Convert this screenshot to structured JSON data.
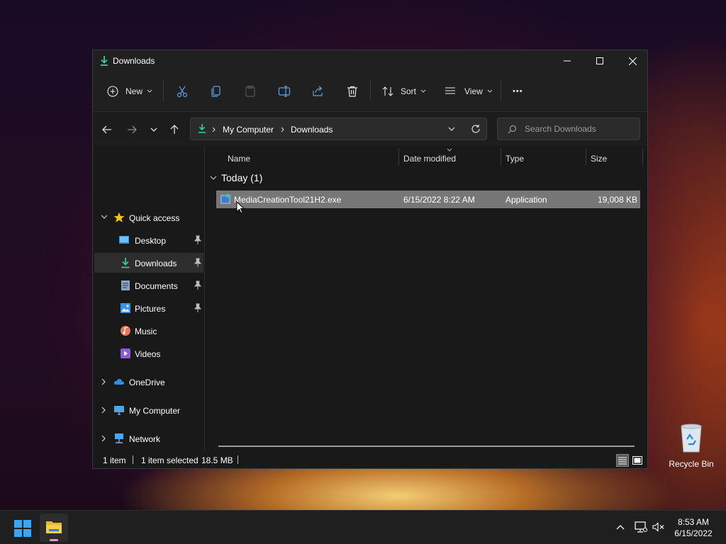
{
  "window": {
    "title": "Downloads",
    "controls": {
      "minimize": "minimize",
      "maximize": "maximize",
      "close": "close"
    }
  },
  "toolbar": {
    "new_label": "New",
    "sort_label": "Sort",
    "view_label": "View",
    "more_label": "•••"
  },
  "address": {
    "segments": [
      "My Computer",
      "Downloads"
    ]
  },
  "search": {
    "placeholder": "Search Downloads"
  },
  "sidebar": {
    "quick_access": "Quick access",
    "items": [
      {
        "label": "Desktop",
        "icon": "desktop-icon",
        "pinned": true
      },
      {
        "label": "Downloads",
        "icon": "download-icon",
        "pinned": true,
        "selected": true
      },
      {
        "label": "Documents",
        "icon": "documents-icon",
        "pinned": true
      },
      {
        "label": "Pictures",
        "icon": "pictures-icon",
        "pinned": true
      },
      {
        "label": "Music",
        "icon": "music-icon",
        "pinned": false
      },
      {
        "label": "Videos",
        "icon": "videos-icon",
        "pinned": false
      }
    ],
    "onedrive": "OneDrive",
    "mycomputer": "My Computer",
    "network": "Network"
  },
  "columns": {
    "name": "Name",
    "date": "Date modified",
    "type": "Type",
    "size": "Size"
  },
  "group": {
    "label": "Today (1)"
  },
  "files": [
    {
      "name": "MediaCreationTool21H2.exe",
      "date": "6/15/2022 8:22 AM",
      "type": "Application",
      "size": "19,008 KB"
    }
  ],
  "status": {
    "count": "1 item",
    "selected": "1 item selected",
    "size": "18.5 MB"
  },
  "desktop": {
    "recycle_bin": "Recycle Bin"
  },
  "taskbar": {
    "time": "8:53 AM",
    "date": "6/15/2022"
  },
  "colors": {
    "accent": "#4cc2a4",
    "selection": "#777777",
    "window_bg": "#191919"
  }
}
